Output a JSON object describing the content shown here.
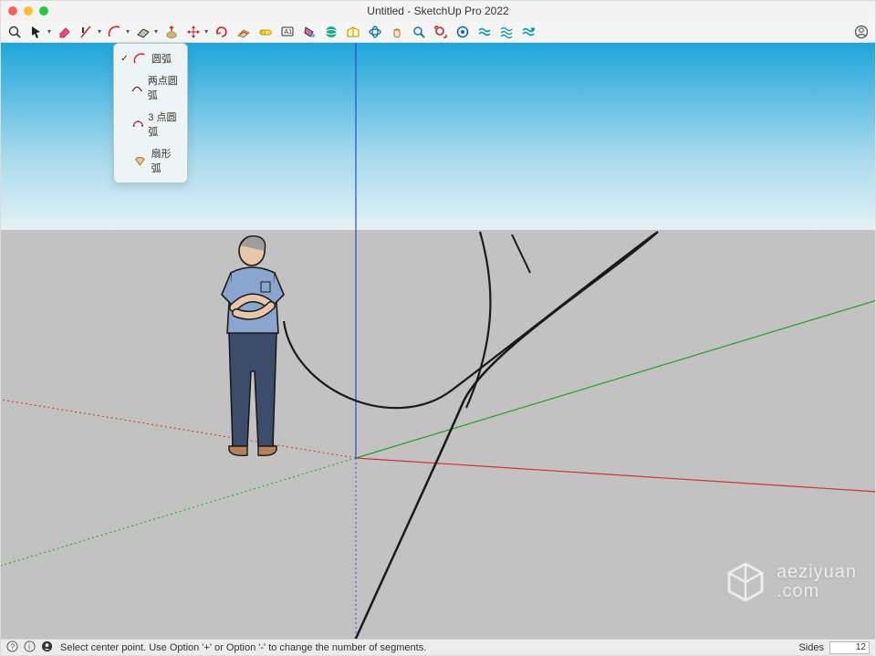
{
  "window": {
    "title": "Untitled - SketchUp Pro 2022"
  },
  "toolbar": {
    "items": [
      "search",
      "select",
      "dd",
      "eraser",
      "line",
      "dd",
      "arc",
      "dd",
      "rect",
      "dd",
      "pushpull",
      "move",
      "dd",
      "rotate",
      "offset",
      "tape",
      "text",
      "paint",
      "add-location",
      "3dw",
      "orbit",
      "pan",
      "zoom",
      "zoom-extents",
      "extension",
      "extension2",
      "extension3",
      "extension4"
    ]
  },
  "arc_menu": {
    "items": [
      {
        "checked": true,
        "icon": "arc-center",
        "label": "圆弧"
      },
      {
        "checked": false,
        "icon": "arc-2pt",
        "label": "两点圆弧"
      },
      {
        "checked": false,
        "icon": "arc-3pt",
        "label": "3 点圆弧"
      },
      {
        "checked": false,
        "icon": "arc-pie",
        "label": "扇形弧"
      }
    ]
  },
  "status": {
    "hint": "Select center point. Use Option '+' or Option '-' to change the number of segments.",
    "vcb_label": "Sides",
    "vcb_value": "12"
  },
  "watermark": {
    "line1": "aeziyuan",
    "line2": ".com"
  }
}
